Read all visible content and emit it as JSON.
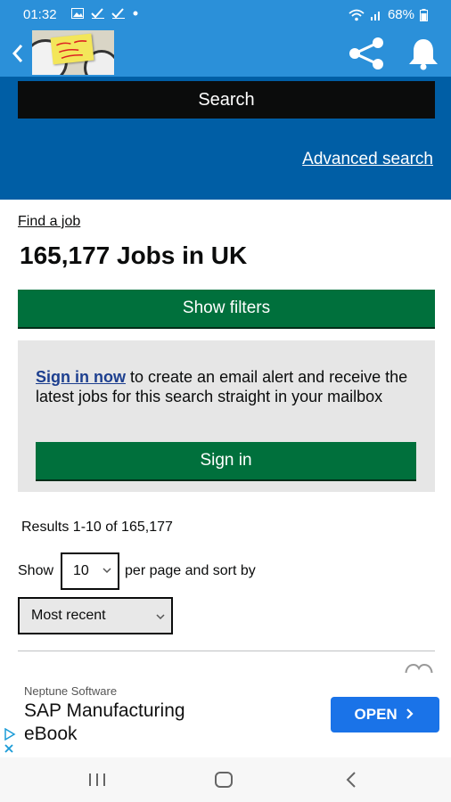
{
  "status_bar": {
    "time": "01:32",
    "battery": "68%",
    "left_icons": [
      "image-icon",
      "check-icon",
      "check-icon",
      "dot-icon"
    ],
    "right_icons": [
      "wifi-icon",
      "signal-icon",
      "battery-icon"
    ]
  },
  "app_bar": {
    "logo_alt": "Time for a new job",
    "icons": [
      "back-icon",
      "share-icon",
      "bell-icon"
    ]
  },
  "search": {
    "button_label": "Search",
    "advanced_link": "Advanced search"
  },
  "breadcrumb": "Find a job",
  "title": "165,177 Jobs in UK",
  "filters_button": "Show filters",
  "alert": {
    "link": "Sign in now",
    "text": " to create an email alert and receive the latest jobs for this search straight in your mailbox",
    "button": "Sign in"
  },
  "results": {
    "summary": "Results 1-10 of 165,177",
    "show_label": "Show",
    "per_page": "10",
    "per_page_suffix": "per page and sort by",
    "sort_by": "Most recent"
  },
  "ad": {
    "advertiser": "Neptune Software",
    "headline_line1": "SAP Manufacturing",
    "headline_line2": "eBook",
    "cta": "OPEN",
    "cta_icon": "chevron-right-icon"
  },
  "colors": {
    "status_bar": "#2b90d9",
    "header": "#005ea5",
    "green_button": "#00703c",
    "panel": "#e6e6e6",
    "ad_button": "#1a73e8"
  }
}
